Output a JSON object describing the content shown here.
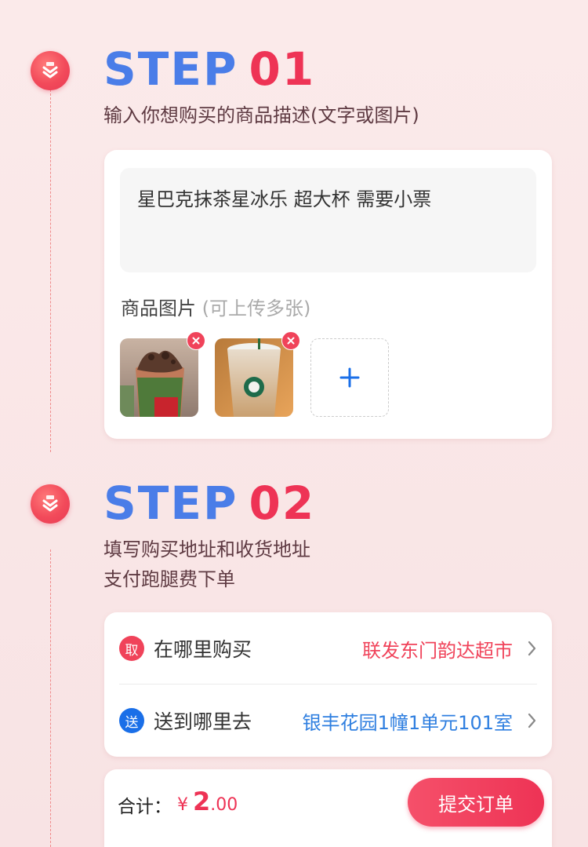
{
  "step1": {
    "word": "STEP",
    "num": "01",
    "description": "输入你想购买的商品描述(文字或图片)",
    "product_description": "星巴克抹茶星冰乐 超大杯 需要小票",
    "images_label": "商品图片",
    "images_hint": "(可上传多张)",
    "add_icon": "plus-icon",
    "delete_icon": "close-icon"
  },
  "step2": {
    "word": "STEP",
    "num": "02",
    "description_line1": "填写购买地址和收货地址",
    "description_line2": "支付跑腿费下单",
    "pickup": {
      "badge": "取",
      "label": "在哪里购买",
      "value": "联发东门韵达超市",
      "badge_color": "#f0435a",
      "value_color": "#f0435a"
    },
    "delivery": {
      "badge": "送",
      "label": "送到哪里去",
      "value": "银丰花园1幢1单元101室",
      "badge_color": "#1a6fe8",
      "value_color": "#2f7fe0"
    }
  },
  "order": {
    "total_label": "合计：",
    "currency": "¥",
    "amount_int": "2",
    "amount_dec": ".00",
    "submit_label": "提交订单"
  },
  "colors": {
    "accent_red": "#ee3355",
    "accent_blue": "#4a7de8"
  }
}
